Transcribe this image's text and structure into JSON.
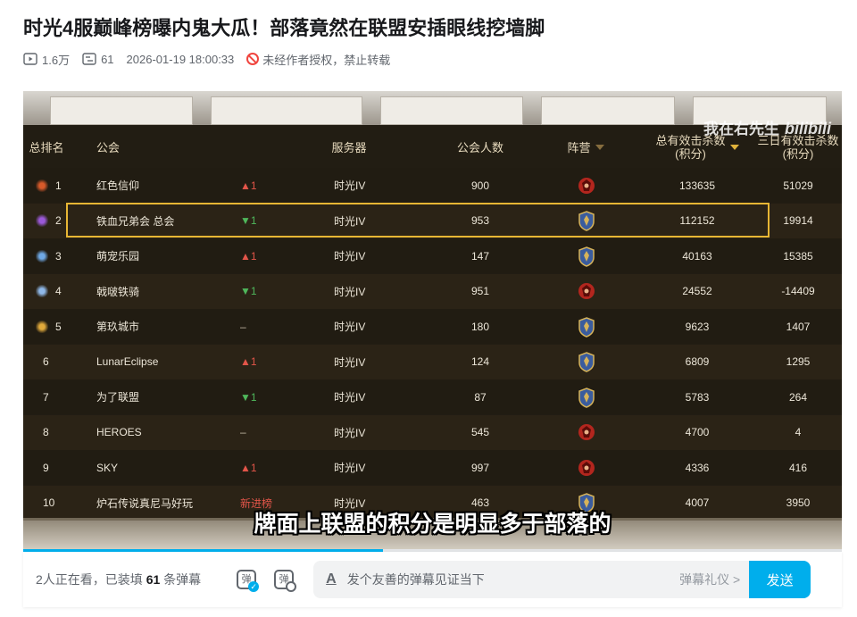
{
  "page": {
    "title": "时光4服巅峰榜曝内鬼大瓜！部落竟然在联盟安插眼线挖墙脚",
    "meta": {
      "views": "1.6万",
      "danmaku_count": "61",
      "datetime": "2026-01-19 18:00:33",
      "copyright": "未经作者授权，禁止转载"
    }
  },
  "video": {
    "watermark_text": "我在右先生",
    "watermark_logo": "bilibili",
    "subtitle": "牌面上联盟的积分是明显多于部落的",
    "progress_fraction": 0.44,
    "table": {
      "headers": {
        "rank": "总排名",
        "guild": "公会",
        "server": "服务器",
        "members": "公会人数",
        "faction": "阵营",
        "total_line1": "总有效击杀数",
        "total_line2": "(积分)",
        "three_line1": "三日有效击杀数",
        "three_line2": "(积分)"
      },
      "rows": [
        {
          "rank": "1",
          "guild": "红色信仰",
          "change": "▲1",
          "change_type": "up",
          "server": "时光IV",
          "members": "900",
          "faction": "horde",
          "total": "133635",
          "three": "51029",
          "icon_color": "#d85a2a"
        },
        {
          "rank": "2",
          "guild": "铁血兄弟会 总会",
          "change": "▼1",
          "change_type": "down",
          "server": "时光IV",
          "members": "953",
          "faction": "alliance",
          "total": "112152",
          "three": "19914",
          "icon_color": "#9b59d9"
        },
        {
          "rank": "3",
          "guild": "萌宠乐园",
          "change": "▲1",
          "change_type": "up",
          "server": "时光IV",
          "members": "147",
          "faction": "alliance",
          "total": "40163",
          "three": "15385",
          "icon_color": "#6fa9e6"
        },
        {
          "rank": "4",
          "guild": "戟啵铁骑",
          "change": "▼1",
          "change_type": "down",
          "server": "时光IV",
          "members": "951",
          "faction": "horde",
          "total": "24552",
          "three": "-14409",
          "icon_color": "#8fb8e8"
        },
        {
          "rank": "5",
          "guild": "第玖城市",
          "change": "–",
          "change_type": "same",
          "server": "时光IV",
          "members": "180",
          "faction": "alliance",
          "total": "9623",
          "three": "1407",
          "icon_color": "#e0a93b"
        },
        {
          "rank": "6",
          "guild": "LunarEclipse",
          "change": "▲1",
          "change_type": "up",
          "server": "时光IV",
          "members": "124",
          "faction": "alliance",
          "total": "6809",
          "three": "1295",
          "icon_color": ""
        },
        {
          "rank": "7",
          "guild": "为了联盟",
          "change": "▼1",
          "change_type": "down",
          "server": "时光IV",
          "members": "87",
          "faction": "alliance",
          "total": "5783",
          "three": "264",
          "icon_color": ""
        },
        {
          "rank": "8",
          "guild": "HEROES",
          "change": "–",
          "change_type": "same",
          "server": "时光IV",
          "members": "545",
          "faction": "horde",
          "total": "4700",
          "three": "4",
          "icon_color": ""
        },
        {
          "rank": "9",
          "guild": "SKY",
          "change": "▲1",
          "change_type": "up",
          "server": "时光IV",
          "members": "997",
          "faction": "horde",
          "total": "4336",
          "three": "416",
          "icon_color": ""
        },
        {
          "rank": "10",
          "guild": "炉石传说真尼马好玩",
          "change": "新进榜",
          "change_type": "new",
          "server": "时光IV",
          "members": "463",
          "faction": "alliance",
          "total": "4007",
          "three": "3950",
          "icon_color": ""
        }
      ]
    }
  },
  "danmaku_bar": {
    "viewers_prefix": "2人正在看，已装填",
    "viewers_count": "61",
    "viewers_suffix": "条弹幕",
    "toggle_label": "弹",
    "setting_label": "弹",
    "input_icon": "A",
    "placeholder": "发个友善的弹幕见证当下",
    "etiquette": "弹幕礼仪 >",
    "send_label": "发送"
  },
  "colors": {
    "accent": "#00aeec",
    "highlight_border": "#e7b634",
    "horde": "#b3261e",
    "alliance": "#3a5c9e"
  }
}
